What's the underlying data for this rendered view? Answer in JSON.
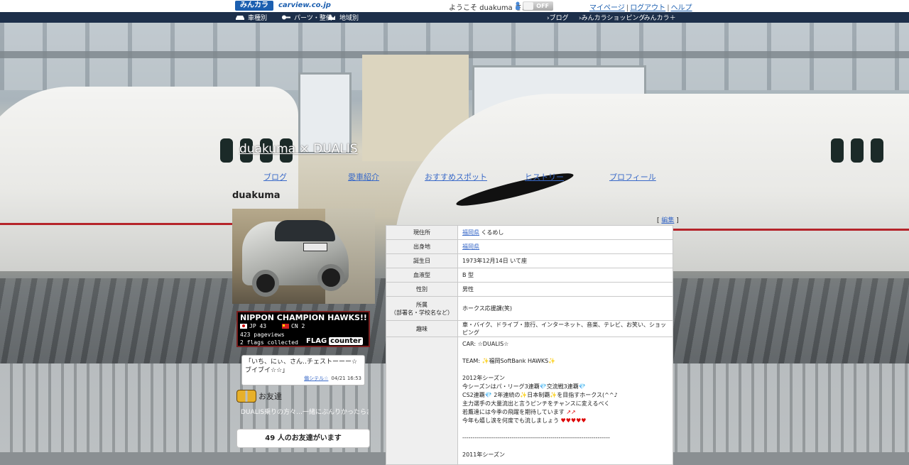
{
  "topbar": {
    "logo_minkara": "みんカラ",
    "logo_carview": "carview.co.jp",
    "welcome": "ようこそ duakuma さん",
    "toggle_label": "OFF",
    "links": [
      "マイページ",
      "ログアウト",
      "ヘルプ"
    ]
  },
  "navbar": {
    "left": [
      "車種別",
      "パーツ・整備",
      "地域別"
    ],
    "right": [
      "›ブログ",
      "›みんカラショッピング",
      "›みんカラ＋"
    ]
  },
  "blog": {
    "title": "duakuma × DUALIS",
    "tabs": [
      "ブログ",
      "愛車紹介",
      "おすすめスポット",
      "ヒストリー",
      "プロフィール"
    ]
  },
  "sidebar": {
    "username": "duakuma",
    "flag_counter": {
      "title": "NIPPON CHAMPION HAWKS!!",
      "jp": "JP 43",
      "cn": "CN 2",
      "pageviews": "423 pageviews",
      "flags": "2 flags collected",
      "logo_flag": "FLAG",
      "logo_counter": "counter"
    },
    "comment": {
      "text": "「いち、にぃ、さん‥チェストーーー☆ブイブイ☆☆」",
      "author": "偏シテル☆",
      "time": "04/21 16:53"
    },
    "friends": {
      "heading": "お友達",
      "desc": "DUALIS乗りの方々…一緒にぶんりかったらお友達になりましょう♪",
      "button": "49 人のお友達がいます"
    }
  },
  "profile": {
    "edit_open": "[",
    "edit_label": "編集",
    "edit_close": "]",
    "rows": [
      {
        "label": "現住所",
        "link": "福岡県",
        "value": " くるめし"
      },
      {
        "label": "出身地",
        "link": "福岡県",
        "value": ""
      },
      {
        "label": "誕生日",
        "link": "",
        "value": "1973年12月14日 いて座"
      },
      {
        "label": "血液型",
        "link": "",
        "value": "B 型"
      },
      {
        "label": "性別",
        "link": "",
        "value": "男性"
      },
      {
        "label": "所属\n（部署名・学校名など）",
        "link": "",
        "value": "ホークス応援課(笑)"
      },
      {
        "label": "趣味",
        "link": "",
        "value": "車・バイク、ドライブ・旅行、インターネット、音楽、テレビ、お笑い、ショッピング"
      }
    ],
    "intro": {
      "car": "CAR: ☆DUALIS☆",
      "team_prefix": "TEAM: ",
      "team": "福岡SoftBank HAWKS",
      "season_2012": "2012年シーズン",
      "line1": "今シーズンはパ・リーグ3連覇💎交流戦3連覇💎",
      "line2": "CS2連覇💎 2年連続の✨日本制覇✨を目指すホークス(^^♪",
      "line3": "主力選手の大量流出と言うピンチをチャンスに変えるべく",
      "line4": "若鷹達には今季の飛躍を期待しています",
      "line5": "今年も嬉し涙を何度でも流しましょう",
      "hearts": "♥♥♥♥♥",
      "arrows": "↗↗",
      "divider": "------------------------------------------------------------------------",
      "season_2011": "2011年シーズン"
    }
  }
}
